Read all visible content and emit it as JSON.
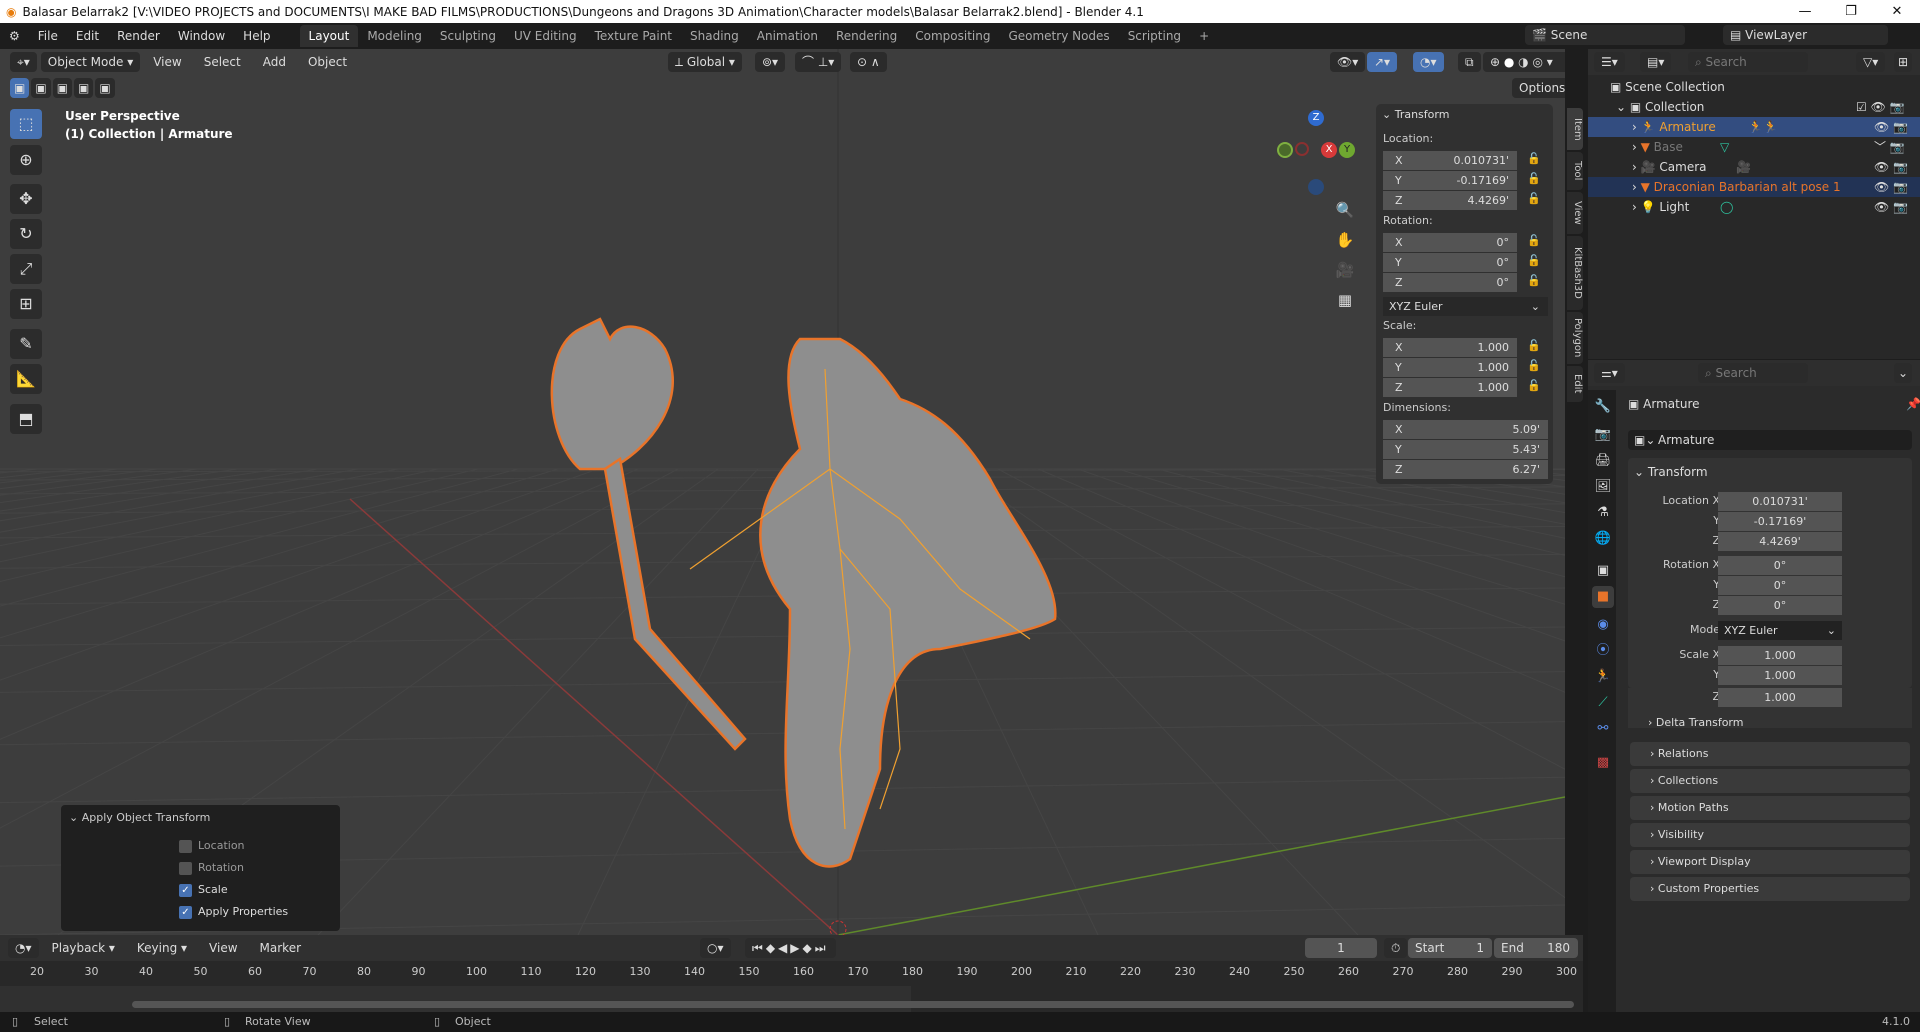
{
  "window": {
    "title": "Balasar Belarrak2 [V:\\VIDEO PROJECTS and DOCUMENTS\\I MAKE BAD FILMS\\PRODUCTIONS\\Dungeons and Dragons 3D Animation\\Character models\\Balasar Belarrak2.blend] - Blender 4.1"
  },
  "menu": [
    "File",
    "Edit",
    "Render",
    "Window",
    "Help"
  ],
  "workspaces": [
    "Layout",
    "Modeling",
    "Sculpting",
    "UV Editing",
    "Texture Paint",
    "Shading",
    "Animation",
    "Rendering",
    "Compositing",
    "Geometry Nodes",
    "Scripting"
  ],
  "scene": {
    "name": "Scene",
    "view_layer": "ViewLayer"
  },
  "viewport": {
    "mode": "Object Mode",
    "menus": [
      "View",
      "Select",
      "Add",
      "Object"
    ],
    "orientation": "Global",
    "options": "Options",
    "overlay_title": "User Perspective",
    "overlay_subtitle": "(1) Collection | Armature",
    "gizmo": {
      "x": "X",
      "y": "Y",
      "z": "Z"
    }
  },
  "npanel": {
    "tabs": [
      "Item",
      "Tool",
      "View",
      "KitBash3D",
      "Polygon",
      "Edit"
    ],
    "title": "Transform",
    "location_label": "Location:",
    "location": [
      {
        "axis": "X",
        "value": "0.010731'"
      },
      {
        "axis": "Y",
        "value": "-0.17169'"
      },
      {
        "axis": "Z",
        "value": "4.4269'"
      }
    ],
    "rotation_label": "Rotation:",
    "rotation": [
      {
        "axis": "X",
        "value": "0°"
      },
      {
        "axis": "Y",
        "value": "0°"
      },
      {
        "axis": "Z",
        "value": "0°"
      }
    ],
    "rotation_mode": "XYZ Euler",
    "scale_label": "Scale:",
    "scale": [
      {
        "axis": "X",
        "value": "1.000"
      },
      {
        "axis": "Y",
        "value": "1.000"
      },
      {
        "axis": "Z",
        "value": "1.000"
      }
    ],
    "dimensions_label": "Dimensions:",
    "dimensions": [
      {
        "axis": "X",
        "value": "5.09'"
      },
      {
        "axis": "Y",
        "value": "5.43'"
      },
      {
        "axis": "Z",
        "value": "6.27'"
      }
    ]
  },
  "apply_panel": {
    "title": "Apply Object Transform",
    "options": [
      {
        "label": "Location",
        "checked": false
      },
      {
        "label": "Rotation",
        "checked": false
      },
      {
        "label": "Scale",
        "checked": true
      },
      {
        "label": "Apply Properties",
        "checked": true
      }
    ]
  },
  "outliner": {
    "search_placeholder": "Search",
    "root": "Scene Collection",
    "collection": "Collection",
    "items": [
      {
        "name": "Armature",
        "color": "#f0a030",
        "selected": true
      },
      {
        "name": "Base",
        "color": "#777777"
      },
      {
        "name": "Camera",
        "color": "#dddddd"
      },
      {
        "name": "Draconian Barbarian alt pose 1",
        "color": "#e8742a",
        "highlight": true
      },
      {
        "name": "Light",
        "color": "#dddddd"
      }
    ]
  },
  "properties": {
    "search_placeholder": "Search",
    "object_name": "Armature",
    "datablock": "Armature",
    "panel": "Transform",
    "location_label": "Location X",
    "location": [
      "0.010731'",
      "-0.17169'",
      "4.4269'"
    ],
    "rotation_label": "Rotation X",
    "rotation": [
      "0°",
      "0°",
      "0°"
    ],
    "mode_label": "Mode",
    "mode": "XYZ Euler",
    "scale_label": "Scale X",
    "scale": [
      "1.000",
      "1.000",
      "1.000"
    ],
    "axis_y": "Y",
    "axis_z": "Z",
    "subpanels": [
      "Delta Transform",
      "Relations",
      "Collections",
      "Motion Paths",
      "Visibility",
      "Viewport Display",
      "Custom Properties"
    ]
  },
  "timeline": {
    "menus": [
      "Playback",
      "Keying",
      "View",
      "Marker"
    ],
    "current_frame": "1",
    "start_label": "Start",
    "start": "1",
    "end_label": "End",
    "end": "180",
    "ticks": [
      "20",
      "30",
      "40",
      "50",
      "60",
      "70",
      "80",
      "90",
      "100",
      "110",
      "120",
      "130",
      "140",
      "150",
      "160",
      "170",
      "180",
      "190",
      "200",
      "210",
      "220",
      "230",
      "240",
      "250",
      "260",
      "270",
      "280",
      "290",
      "300"
    ]
  },
  "status": {
    "select": "Select",
    "rotate": "Rotate View",
    "object": "Object",
    "version": "4.1.0"
  }
}
